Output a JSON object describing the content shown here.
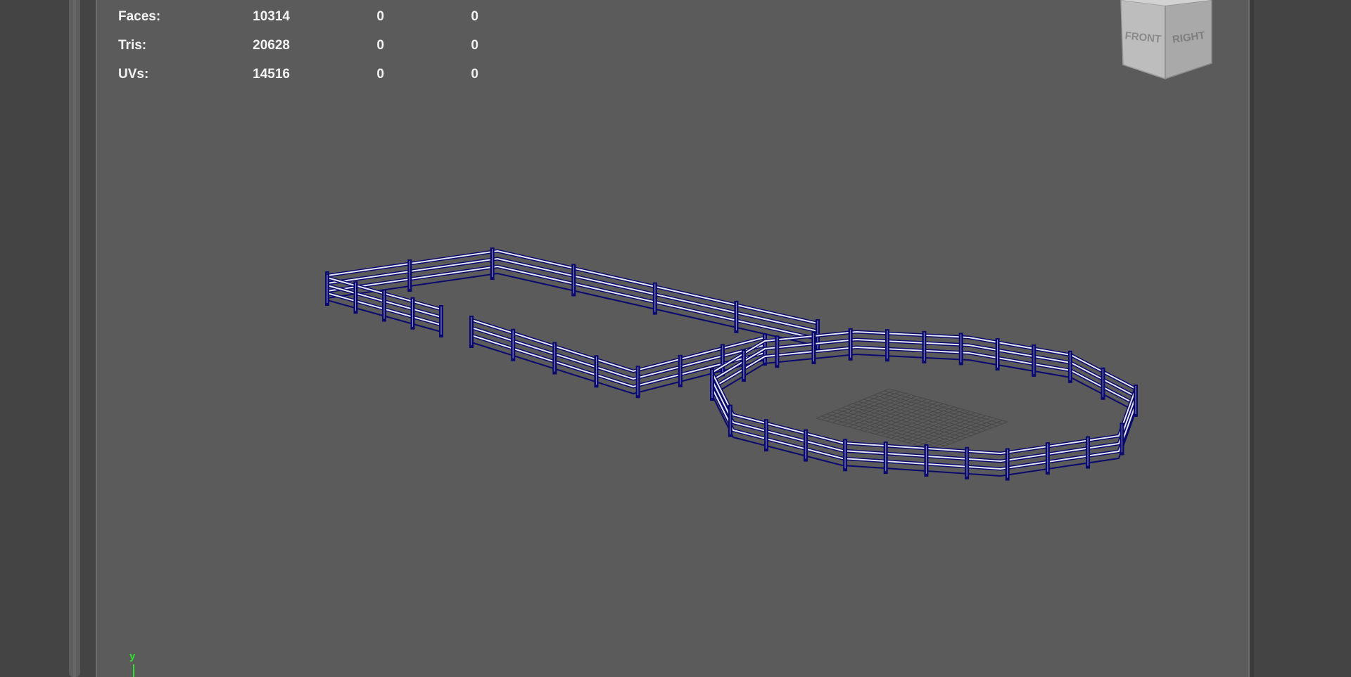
{
  "hud": {
    "rows": [
      {
        "label": "Faces:",
        "v1": "10314",
        "v2": "0",
        "v3": "0"
      },
      {
        "label": "Tris:",
        "v1": "20628",
        "v2": "0",
        "v3": "0"
      },
      {
        "label": "UVs:",
        "v1": "14516",
        "v2": "0",
        "v3": "0"
      }
    ]
  },
  "viewcube": {
    "front_label": "FRONT",
    "right_label": "RIGHT"
  },
  "axis": {
    "y_label": "y"
  },
  "colors": {
    "viewport_bg": "#5b5b5b",
    "wireframe": "#0a0a6e",
    "rail_highlight": "#e8e8f4",
    "axis_green": "#2fe02f"
  },
  "scene": {
    "object": "fence-wireframe"
  }
}
